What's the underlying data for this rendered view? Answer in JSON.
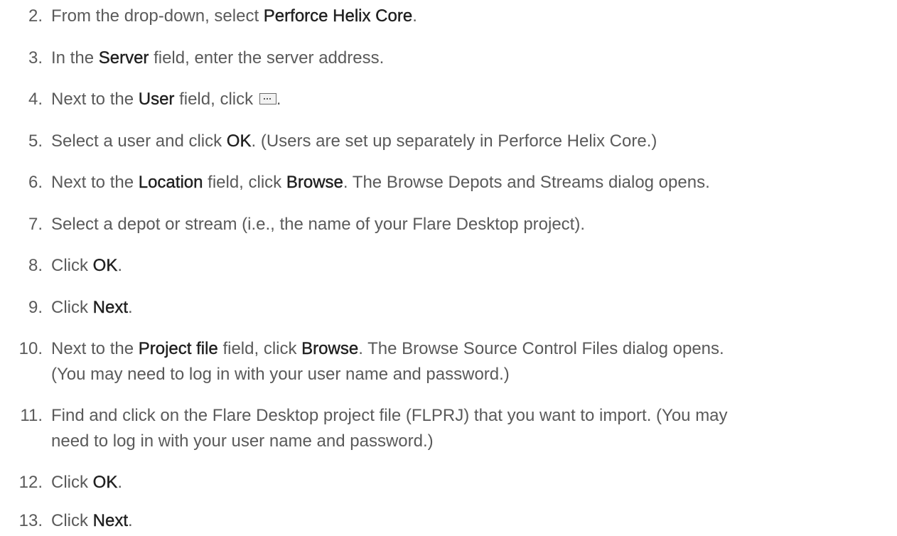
{
  "steps": [
    {
      "num": "2.",
      "parts": [
        "From the drop-down, select ",
        "Perforce Helix Core",
        "."
      ]
    },
    {
      "num": "3.",
      "parts": [
        "In the ",
        "Server",
        " field, enter the server address."
      ]
    },
    {
      "num": "4.",
      "parts": [
        "Next to the ",
        "User",
        " field, click ",
        "."
      ],
      "icon": "ellipsis-button-icon"
    },
    {
      "num": "5.",
      "parts": [
        "Select a user and click ",
        "OK",
        ". (Users are set up separately in Perforce Helix Core.)"
      ]
    },
    {
      "num": "6.",
      "parts": [
        "Next to the ",
        "Location",
        " field, click ",
        "Browse",
        ". The Browse Depots and Streams dialog opens."
      ]
    },
    {
      "num": "7.",
      "parts": [
        "Select a depot or stream (i.e., the name of your Flare Desktop project)."
      ]
    },
    {
      "num": "8.",
      "parts": [
        "Click ",
        "OK",
        "."
      ]
    },
    {
      "num": "9.",
      "parts": [
        "Click ",
        "Next",
        "."
      ]
    },
    {
      "num": "10.",
      "parts": [
        "Next to the ",
        "Project file",
        " field, click ",
        "Browse",
        ". The Browse Source Control Files dialog opens."
      ],
      "line2": "(You may need to log in with your user name and password.)"
    },
    {
      "num": "11.",
      "parts": [
        "Find and click on the Flare Desktop project file (FLPRJ) that you want to import. (You may"
      ],
      "line2": "need to log in with your user name and password.)"
    },
    {
      "num": "12.",
      "parts": [
        "Click ",
        "OK",
        "."
      ]
    },
    {
      "num": "13.",
      "parts": [
        "Click ",
        "Next",
        "."
      ]
    }
  ]
}
